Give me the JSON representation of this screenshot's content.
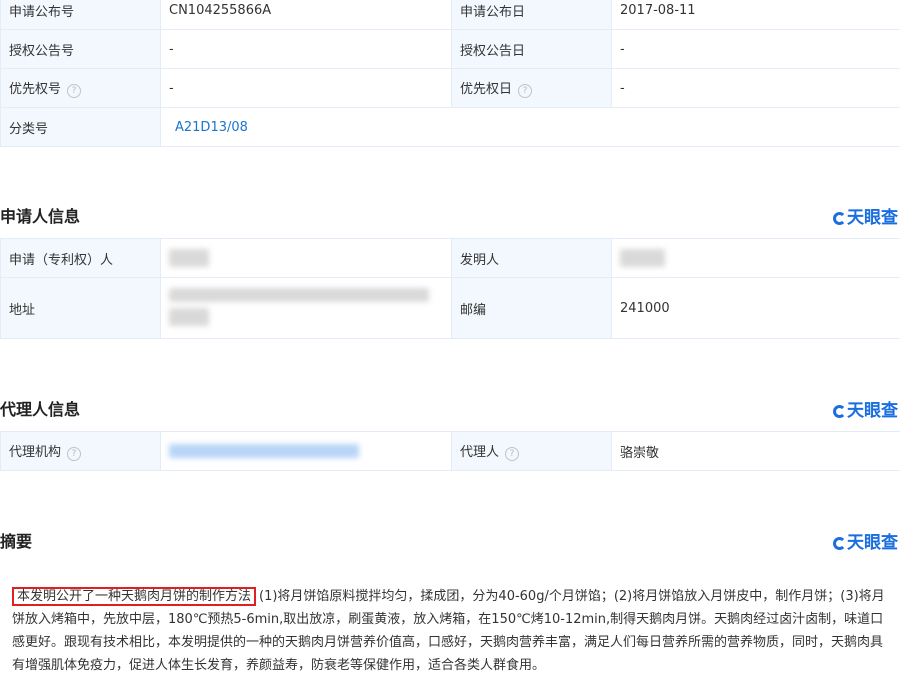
{
  "top_table": {
    "row1": {
      "l1": "申请公布号",
      "v1": "CN104255866A",
      "l2": "申请公布日",
      "v2": "2017-08-11"
    },
    "row2": {
      "l1": "授权公告号",
      "v1": "-",
      "l2": "授权公告日",
      "v2": "-"
    },
    "row3": {
      "l1": "优先权号",
      "v1": "-",
      "l2": "优先权日",
      "v2": "-"
    },
    "row4": {
      "l1": "分类号",
      "v1": "A21D13/08"
    }
  },
  "brand": "天眼查",
  "applicant": {
    "title": "申请人信息",
    "applicant_label": "申请（专利权）人",
    "inventor_label": "发明人",
    "address_label": "地址",
    "zip_label": "邮编",
    "zip_value": "241000"
  },
  "agent": {
    "title": "代理人信息",
    "agency_label": "代理机构",
    "agent_label": "代理人",
    "agent_value": "骆崇敬"
  },
  "abstract": {
    "title": "摘要",
    "highlight": "本发明公开了一种天鹅肉月饼的制作方法",
    "text": "(1)将月饼馅原料搅拌均匀，揉成团，分为40-60g/个月饼馅；(2)将月饼馅放入月饼皮中，制作月饼；(3)将月饼放入烤箱中，先放中层，180℃预热5-6min,取出放凉，刷蛋黄液，放入烤箱，在150℃烤10-12min,制得天鹅肉月饼。天鹅肉经过卤汁卤制，味道口感更好。跟现有技术相比，本发明提供的一种的天鹅肉月饼营养价值高，口感好，天鹅肉营养丰富，满足人们每日营养所需的营养物质，同时，天鹅肉具有增强肌体免疫力，促进人体生长发育，养颜益寿，防衰老等保健作用，适合各类人群食用。"
  }
}
